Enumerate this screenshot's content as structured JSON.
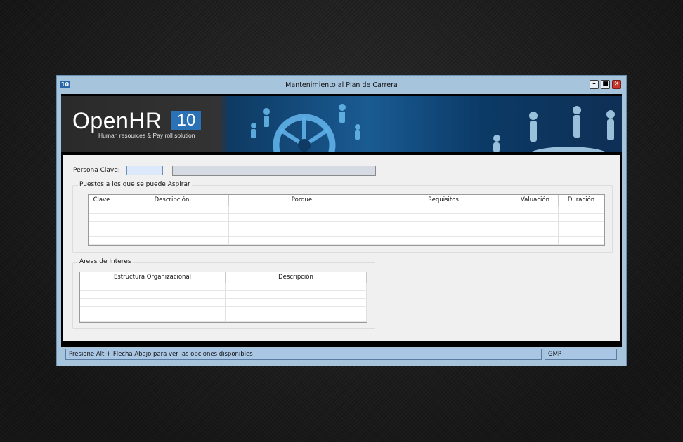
{
  "window": {
    "title": "Mantenimiento al Plan de Carrera",
    "app_icon_text": "10",
    "controls": {
      "minimize_icon": "minimize-icon",
      "maximize_icon": "maximize-icon",
      "close_icon": "close-icon"
    }
  },
  "banner": {
    "logo_text": "OpenHR",
    "logo_badge": "10",
    "tagline": "Human resources & Pay roll solution"
  },
  "form": {
    "persona_label": "Persona Clave:",
    "persona_value": "",
    "persona_desc_value": "",
    "puestos_title": "Puestos a los que se puede Aspirar",
    "puestos_columns": [
      "Clave",
      "Descripción",
      "Porque",
      "Requisitos",
      "Valuación",
      "Duración"
    ],
    "areas_title": "Areas de Interes",
    "areas_columns": [
      "Estructura Organizacional",
      "Descripción"
    ]
  },
  "statusbar": {
    "message": "Presione Alt + Flecha Abajo para ver las opciones disponibles",
    "user": "GMP"
  },
  "colors": {
    "titlebar": "#a7c4dd",
    "form_bg": "#f0f0f0",
    "input_focus": "#dbe9fb",
    "close_button": "#c8352b",
    "status_bg": "#a9c7e4"
  }
}
